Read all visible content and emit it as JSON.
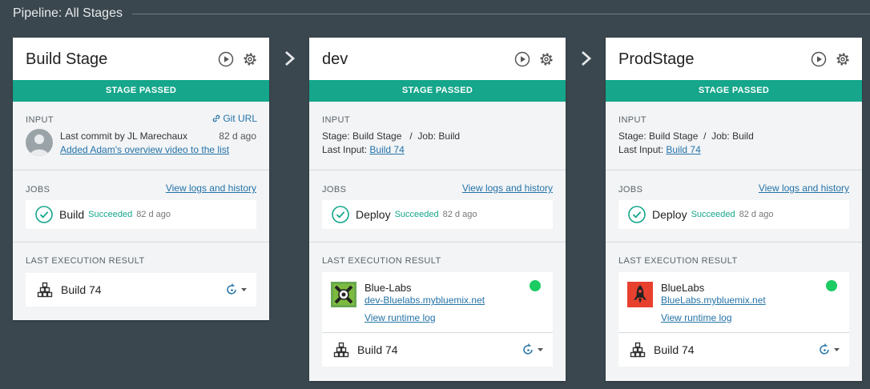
{
  "pipeline": {
    "title": "Pipeline: All Stages"
  },
  "labels": {
    "stage_passed": "STAGE PASSED",
    "input": "INPUT",
    "jobs": "JOBS",
    "last_execution_result": "LAST EXECUTION RESULT",
    "view_logs": "View logs and history",
    "view_runtime_log": "View runtime log",
    "git_url": "Git URL"
  },
  "colors": {
    "accent": "#15a68b",
    "link": "#2573a7",
    "running": "#1ccb62",
    "background": "#3b474e"
  },
  "stages": [
    {
      "name": "Build Stage",
      "input": {
        "commit_by": "Last commit by JL Marechaux",
        "commit_time": "82 d ago",
        "commit_message": "Added Adam's overview video to the list"
      },
      "job": {
        "name": "Build",
        "status": "Succeeded",
        "time": "82 d ago"
      },
      "result": {
        "build": "Build 74"
      }
    },
    {
      "name": "dev",
      "input": {
        "stage_job": "Stage: Build Stage   /  Job: Build",
        "last_input_label": "Last Input:",
        "last_input_link": "Build 74"
      },
      "job": {
        "name": "Deploy",
        "status": "Succeeded",
        "time": "82 d ago"
      },
      "result": {
        "app_name": "Blue-Labs",
        "app_url": "dev-Bluelabs.mybluemix.net",
        "build": "Build 74"
      }
    },
    {
      "name": "ProdStage",
      "input": {
        "stage_job": "Stage: Build Stage  /  Job: Build",
        "last_input_label": "Last Input:",
        "last_input_link": "Build 74"
      },
      "job": {
        "name": "Deploy",
        "status": "Succeeded",
        "time": "82 d ago"
      },
      "result": {
        "app_name": "BlueLabs",
        "app_url": "BlueLabs.mybluemix.net",
        "build": "Build 74"
      }
    }
  ]
}
